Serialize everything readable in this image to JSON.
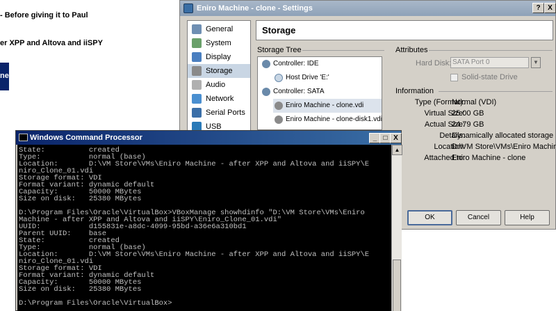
{
  "background_list": {
    "items": [
      {
        "label": "- Before giving it to Paul"
      },
      {
        "label": "er XPP and Altova and iiSPY"
      },
      {
        "label": "ne"
      }
    ]
  },
  "settings": {
    "title": "Eniro Machine - clone - Settings",
    "help_btn": "?",
    "close_btn": "X",
    "sidebar": [
      "General",
      "System",
      "Display",
      "Storage",
      "Audio",
      "Network",
      "Serial Ports",
      "USB"
    ],
    "header": "Storage",
    "storage_tree_label": "Storage Tree",
    "tree": [
      {
        "label": "Controller: IDE"
      },
      {
        "label": "Host Drive 'E:'"
      },
      {
        "label": "Controller: SATA"
      },
      {
        "label": "Eniro Machine - clone.vdi"
      },
      {
        "label": "Eniro Machine - clone-disk1.vdi"
      }
    ],
    "attributes_label": "Attributes",
    "hard_disk_label": "Hard Disk:",
    "hard_disk_value": "SATA Port 0",
    "solid_state_label": "Solid-state Drive",
    "information_label": "Information",
    "info": [
      {
        "label": "Type (Format):",
        "value": "Normal (VDI)"
      },
      {
        "label": "Virtual Size:",
        "value": "25.00 GB"
      },
      {
        "label": "Actual Size:",
        "value": "24.79 GB"
      },
      {
        "label": "Details:",
        "value": "Dynamically allocated storage"
      },
      {
        "label": "Location:",
        "value": "D:\\VM Store\\VMs\\Eniro Machine ..."
      },
      {
        "label": "Attached to:",
        "value": "Eniro Machine - clone"
      }
    ],
    "buttons": {
      "ok": "OK",
      "cancel": "Cancel",
      "help": "Help"
    }
  },
  "cmd": {
    "title": "Windows Command Processor",
    "btn_min": "_",
    "btn_max": "□",
    "btn_close": "X",
    "lines": [
      "State:          created",
      "Type:           normal (base)",
      "Location:       D:\\VM Store\\VMs\\Eniro Machine - after XPP and Altova and iiSPY\\E",
      "niro_Clone_01.vdi",
      "Storage format: VDI",
      "Format variant: dynamic default",
      "Capacity:       50000 MBytes",
      "Size on disk:   25380 MBytes",
      "",
      "D:\\Program Files\\Oracle\\VirtualBox>VBoxManage showhdinfo \"D:\\VM Store\\VMs\\Eniro",
      "Machine - after XPP and Altova and iiSPY\\Eniro_Clone_01.vdi\"",
      "UUID:           d155831e-a8dc-4099-95bd-a36e6a310bd1",
      "Parent UUID:    base",
      "State:          created",
      "Type:           normal (base)",
      "Location:       D:\\VM Store\\VMs\\Eniro Machine - after XPP and Altova and iiSPY\\E",
      "niro_Clone_01.vdi",
      "Storage format: VDI",
      "Format variant: dynamic default",
      "Capacity:       50000 MBytes",
      "Size on disk:   25380 MBytes",
      "",
      "D:\\Program Files\\Oracle\\VirtualBox>"
    ]
  },
  "colors": {
    "selection": "#0a246a",
    "console_bg": "#000000",
    "console_fg": "#c0c0c0"
  }
}
